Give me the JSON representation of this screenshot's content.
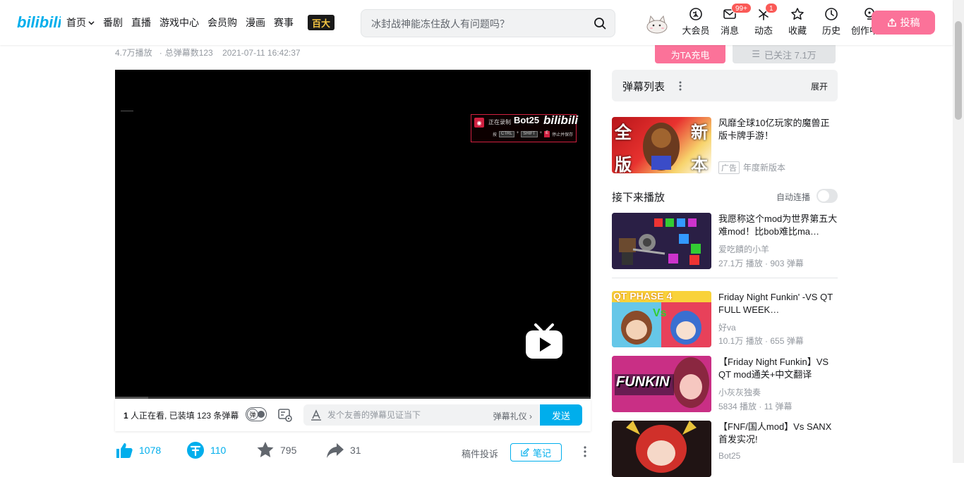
{
  "header": {
    "logo_text": "bilibili",
    "nav": [
      {
        "label": "首页"
      },
      {
        "label": "番剧"
      },
      {
        "label": "直播"
      },
      {
        "label": "游戏中心"
      },
      {
        "label": "会员购"
      },
      {
        "label": "漫画"
      },
      {
        "label": "赛事"
      }
    ],
    "nav_banner_text": "百大",
    "search_placeholder": "冰封战神能冻住敌人有问题吗？",
    "icons": [
      {
        "label": "大会员",
        "icon": "vip-icon"
      },
      {
        "label": "消息",
        "icon": "message-icon",
        "badge": "99+"
      },
      {
        "label": "动态",
        "icon": "dynamic-icon",
        "badge": "1"
      },
      {
        "label": "收藏",
        "icon": "favorite-icon"
      },
      {
        "label": "历史",
        "icon": "history-icon"
      },
      {
        "label": "创作中心",
        "icon": "creator-icon"
      }
    ],
    "upload_label": "投稿"
  },
  "video": {
    "plays": "4.7万播放",
    "danmaku_total": "总弹幕数123",
    "date": "2021-07-11 16:42:37",
    "watermark": {
      "status": "正在录制",
      "name": "Bot25",
      "logo": "bilibili",
      "keys": [
        "CTRL",
        "SHIFT"
      ],
      "hint": "停止并保存",
      "prefix": "按"
    },
    "progress_fraction": 0.07
  },
  "danmaku_bar": {
    "viewers_count": "1",
    "viewers_text": " 人正在看, 已装填 123 条弹幕",
    "toggle_label": "弹",
    "placeholder": "发个友善的弹幕见证当下",
    "etiquette": "弹幕礼仪",
    "send": "发送"
  },
  "toolbar": {
    "like": "1078",
    "coin": "110",
    "favorite": "795",
    "share": "31",
    "report": "稿件投诉",
    "note": "笔记"
  },
  "up": {
    "charge": "为TA充电",
    "follow": "已关注 7.1万"
  },
  "danmaku_list": {
    "title": "弹幕列表",
    "expand": "展开"
  },
  "ad": {
    "title": "风靡全球10亿玩家的魔兽正版卡牌手游！",
    "tag": "广告",
    "sub": "年度新版本",
    "thumb_text": [
      "全",
      "新",
      "版",
      "本"
    ]
  },
  "next_up": {
    "title": "接下来播放",
    "autoplay": "自动连播"
  },
  "recommendations": [
    {
      "title": "我愿称这个mod为世界第五大难mod！比bob难比ma…",
      "author": "爱吃饋的小羊",
      "stats": "27.1万 播放 · 903 弹幕"
    },
    {
      "title": "Friday Night Funkin' -VS QT FULL WEEK…",
      "author": "好va",
      "stats": "10.1万 播放 · 655 弹幕",
      "thumb_text": "QT PHASE 4"
    },
    {
      "title": "【Friday Night Funkin】VS QT mod通关+中文翻译",
      "author": "小灰灰独奏",
      "stats": "5834 播放 · 11 弹幕",
      "thumb_text": "FUNKIN"
    },
    {
      "title": "【FNF/国人mod】Vs SANX首发实况!",
      "author": "Bot25",
      "stats": ""
    }
  ]
}
